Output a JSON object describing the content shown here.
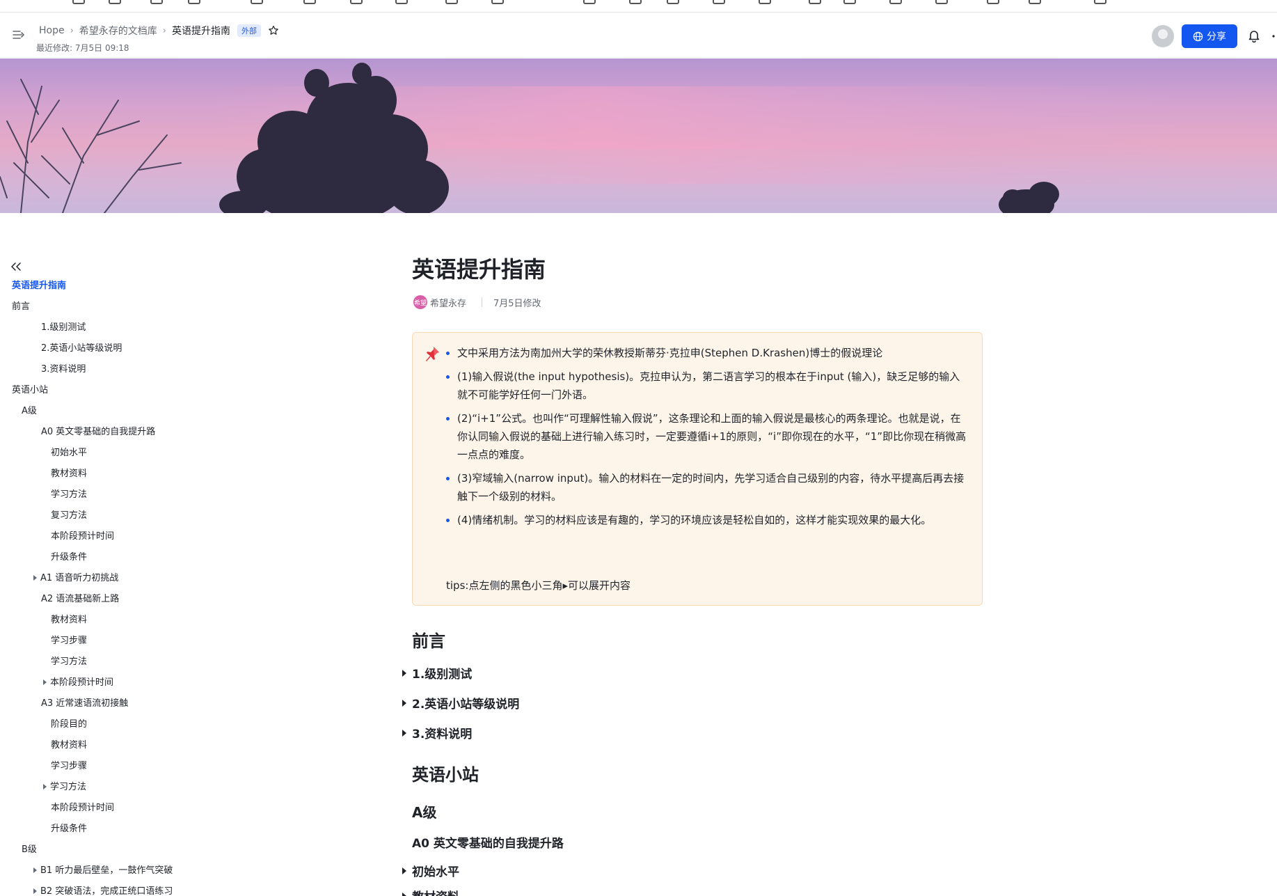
{
  "header": {
    "breadcrumbs": [
      "Hope",
      "希望永存的文档库",
      "英语提升指南"
    ],
    "badge": "外部",
    "last_modified": "最近修改: 7月5日 09:18",
    "share_label": "分享"
  },
  "outline": {
    "items": [
      {
        "label": "英语提升指南"
      },
      {
        "label": "前言"
      },
      {
        "label": "1.级别测试"
      },
      {
        "label": "2.英语小站等级说明"
      },
      {
        "label": "3.资料说明"
      },
      {
        "label": "英语小站"
      },
      {
        "label": "A级"
      },
      {
        "label": "A0 英文零基础的自我提升路"
      },
      {
        "label": "初始水平"
      },
      {
        "label": "教材资料"
      },
      {
        "label": "学习方法"
      },
      {
        "label": "复习方法"
      },
      {
        "label": "本阶段预计时间"
      },
      {
        "label": "升级条件"
      },
      {
        "label": "A1 语音听力初挑战"
      },
      {
        "label": "A2 语流基础新上路"
      },
      {
        "label": "教材资料"
      },
      {
        "label": "学习步骤"
      },
      {
        "label": "学习方法"
      },
      {
        "label": "本阶段预计时间"
      },
      {
        "label": "A3 近常速语流初接触"
      },
      {
        "label": "阶段目的"
      },
      {
        "label": "教材资料"
      },
      {
        "label": "学习步骤"
      },
      {
        "label": "学习方法"
      },
      {
        "label": "本阶段预计时间"
      },
      {
        "label": "升级条件"
      },
      {
        "label": "B级"
      },
      {
        "label": "B1 听力最后壁垒，一鼓作气突破"
      },
      {
        "label": "B2 突破语法，完成正统口语练习"
      }
    ]
  },
  "doc": {
    "title": "英语提升指南",
    "author": "希望永存",
    "author_avatar": "希望",
    "modified": "7月5日修改",
    "callout": {
      "bullets": [
        "文中采用方法为南加州大学的荣休教授斯蒂芬·克拉申(Stephen D.Krashen)博士的假说理论",
        "(1)输入假说(the input hypothesis)。克拉申认为，第二语言学习的根本在于input (输入)，缺乏足够的输入就不可能学好任何一门外语。",
        "(2)“i+1”公式。也叫作“可理解性输入假说”，这条理论和上面的输入假说是最核心的两条理论。也就是说，在你认同输入假说的基础上进行输入练习时，一定要遵循i+1的原则，“i”即你现在的水平，“1”即比你现在稍微高一点点的难度。",
        "(3)窄域输入(narrow input)。输入的材料在一定的时间内，先学习适合自己级别的内容，待水平提高后再去接触下一个级别的材料。",
        "(4)情绪机制。学习的材料应该是有趣的，学习的环境应该是轻松自如的，这样才能实现效果的最大化。"
      ],
      "tips": "tips:点左侧的黑色小三角▸可以展开内容"
    },
    "section_preface": "前言",
    "fold_1": "1.级别测试",
    "fold_2": "2.英语小站等级说明",
    "fold_3": "3.资料说明",
    "section_station": "英语小站",
    "level_a": "A级",
    "a0_title": "A0 英文零基础的自我提升路",
    "fold_initial": "初始水平",
    "fold_materials": "教材资料"
  },
  "colors": {
    "accent": "#1456f0",
    "callout_bg": "#fef5ea",
    "callout_border": "#f8d9b5"
  }
}
